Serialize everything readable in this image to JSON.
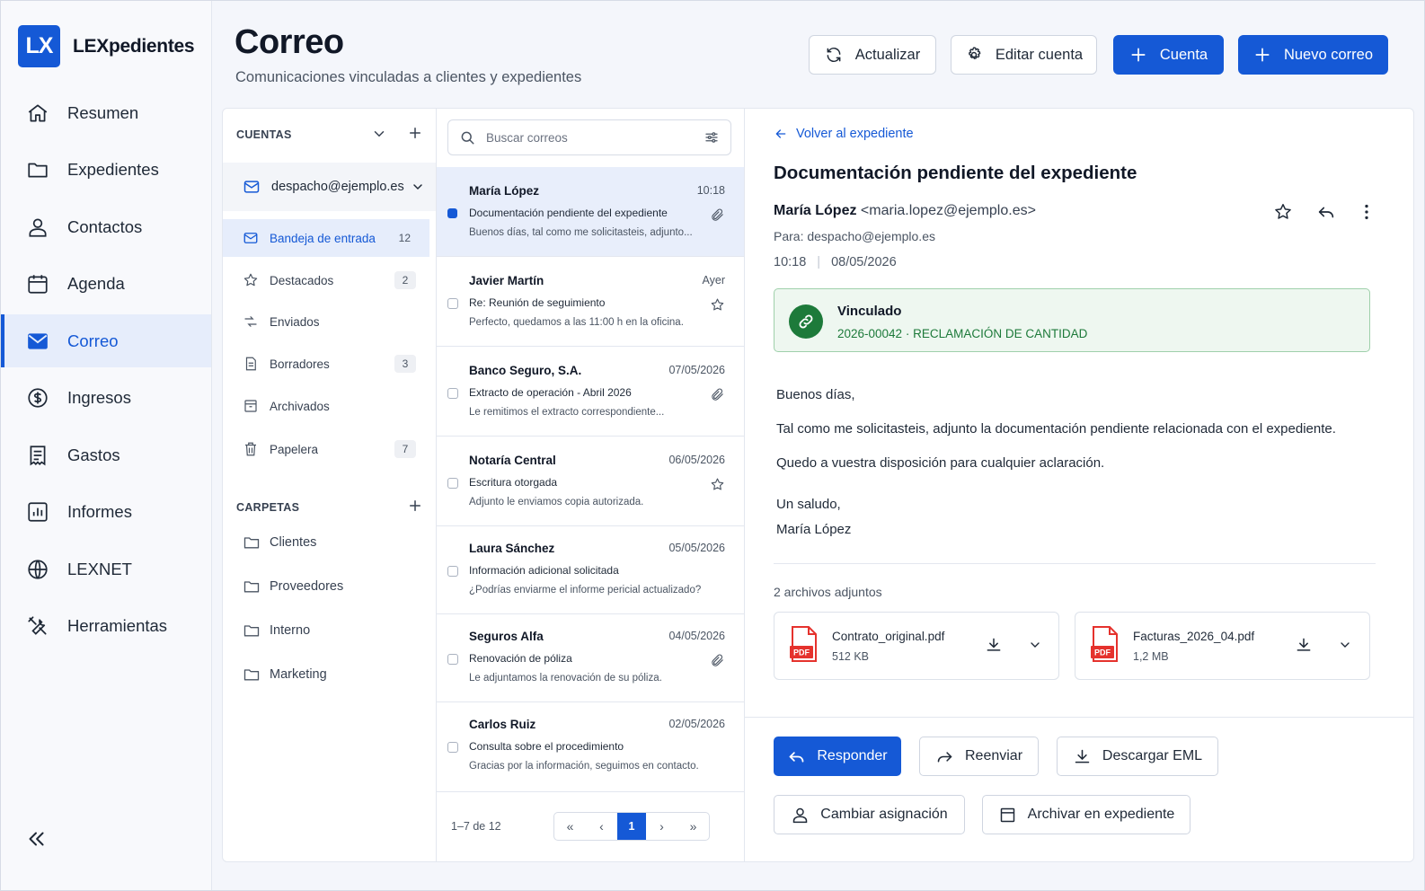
{
  "brand": {
    "logo": "LX",
    "name": "LEXpedientes"
  },
  "nav": {
    "items": [
      {
        "label": "Resumen",
        "icon": "home-icon"
      },
      {
        "label": "Expedientes",
        "icon": "folder-icon"
      },
      {
        "label": "Contactos",
        "icon": "user-icon"
      },
      {
        "label": "Agenda",
        "icon": "calendar-icon"
      },
      {
        "label": "Correo",
        "icon": "mail-icon",
        "active": true
      },
      {
        "label": "Ingresos",
        "icon": "dollar-icon"
      },
      {
        "label": "Gastos",
        "icon": "receipt-icon"
      },
      {
        "label": "Informes",
        "icon": "chart-icon"
      },
      {
        "label": "LEXNET",
        "icon": "globe-icon"
      },
      {
        "label": "Herramientas",
        "icon": "tools-icon"
      }
    ]
  },
  "header": {
    "title": "Correo",
    "subtitle": "Comunicaciones vinculadas a clientes y expedientes",
    "buttons": {
      "refresh": "Actualizar",
      "edit_account": "Editar cuenta",
      "add_account": "Cuenta",
      "new_mail": "Nuevo correo"
    }
  },
  "accounts": {
    "heading": "CUENTAS",
    "email": "despacho@ejemplo.es",
    "folders": [
      {
        "label": "Bandeja de entrada",
        "count": "12",
        "icon": "inbox-icon",
        "active": true
      },
      {
        "label": "Destacados",
        "count": "2",
        "icon": "star-icon"
      },
      {
        "label": "Enviados",
        "count": "",
        "icon": "send-icon"
      },
      {
        "label": "Borradores",
        "count": "3",
        "icon": "draft-icon"
      },
      {
        "label": "Archivados",
        "count": "",
        "icon": "archive-icon"
      },
      {
        "label": "Papelera",
        "count": "7",
        "icon": "trash-icon"
      }
    ],
    "folders_heading": "CARPETAS",
    "custom_folders": [
      "Clientes",
      "Proveedores",
      "Interno",
      "Marketing"
    ]
  },
  "search": {
    "placeholder": "Buscar correos"
  },
  "emails": [
    {
      "from": "María López",
      "date": "10:18",
      "subject": "Documentación pendiente del expediente",
      "preview": "Buenos días, tal como me solicitasteis, adjunto...",
      "icon": "paperclip-icon",
      "unread": true,
      "active": true
    },
    {
      "from": "Javier Martín",
      "date": "Ayer",
      "subject": "Re: Reunión de seguimiento",
      "preview": "Perfecto, quedamos a las 11:00 h en la oficina.",
      "icon": "star-icon"
    },
    {
      "from": "Banco Seguro, S.A.",
      "date": "07/05/2026",
      "subject": "Extracto de operación - Abril 2026",
      "preview": "Le remitimos el extracto correspondiente...",
      "icon": "paperclip-icon"
    },
    {
      "from": "Notaría Central",
      "date": "06/05/2026",
      "subject": "Escritura otorgada",
      "preview": "Adjunto le enviamos copia autorizada.",
      "icon": "star-icon"
    },
    {
      "from": "Laura Sánchez",
      "date": "05/05/2026",
      "subject": "Información adicional solicitada",
      "preview": "¿Podrías enviarme el informe pericial actualizado?",
      "icon": ""
    },
    {
      "from": "Seguros Alfa",
      "date": "04/05/2026",
      "subject": "Renovación de póliza",
      "preview": "Le adjuntamos la renovación de su póliza.",
      "icon": "paperclip-icon"
    },
    {
      "from": "Carlos Ruiz",
      "date": "02/05/2026",
      "subject": "Consulta sobre el procedimiento",
      "preview": "Gracias por la información, seguimos en contacto.",
      "icon": ""
    }
  ],
  "pagination": {
    "range": "1–7 de 12",
    "current": "1",
    "first": "«",
    "prev": "‹",
    "next": "›",
    "last": "»"
  },
  "message": {
    "back": "Volver al expediente",
    "subject": "Documentación pendiente del expediente",
    "sender_name": "María López",
    "sender_email": "<maria.lopez@ejemplo.es>",
    "to": "Para: despacho@ejemplo.es",
    "time": "10:18",
    "date": "08/05/2026",
    "linked_title": "Vinculado",
    "linked_case": "2026-00042 · RECLAMACIÓN DE CANTIDAD",
    "body": [
      "Buenos días,",
      "Tal como me solicitasteis, adjunto la documentación pendiente relacionada con el expediente.",
      "Quedo a vuestra disposición para cualquier aclaración.",
      "Un saludo,",
      "María López"
    ],
    "attachments_title": "2 archivos adjuntos",
    "attachments": [
      {
        "name": "Contrato_original.pdf",
        "size": "512 KB",
        "badge": "PDF"
      },
      {
        "name": "Facturas_2026_04.pdf",
        "size": "1,2 MB",
        "badge": "PDF"
      }
    ],
    "actions": {
      "reply": "Responder",
      "forward": "Reenviar",
      "download_eml": "Descargar EML",
      "change_assignment": "Cambiar asignación",
      "archive": "Archivar en expediente"
    }
  },
  "colors": {
    "accent": "#1559d6",
    "linked_green": "#1d7a3a",
    "linked_bg": "#eef7f0",
    "pdf_red": "#e5322d"
  }
}
